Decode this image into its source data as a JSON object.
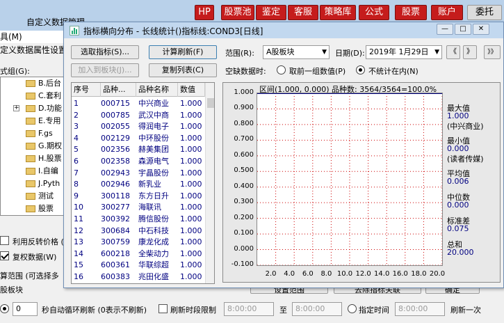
{
  "back_window": {
    "title": "自定义数据管理",
    "menu_fragment": "具(M)",
    "attr_label": "定义数据属性设置",
    "group_label": "式组(G):",
    "tree_items": [
      "B.后台",
      "C.套利",
      "D.功能",
      "E.专用",
      "F.gs ",
      "G.期权",
      "H.股票",
      "I.自编",
      "J.Pyth",
      "测试",
      "股票"
    ],
    "check_reverse": "利用反转价格 (K",
    "check_reinstate": "复权数据(W)",
    "calc_range_label": "算范围 (可选择多",
    "board_label": "股板块",
    "btn_set_range": "设置范围",
    "btn_delete_target": "去除指标关联",
    "btn_ok": "确定",
    "auto_refresh_value": "0",
    "auto_refresh_label": "秒自动循环刷新 (0表示不刷新)",
    "refresh_period_label": "刷新时段限制",
    "time_from": "8:00:00",
    "time_to_label": "至",
    "time_to": "8:00:00",
    "specified_time_label": "指定时间",
    "specified_time": "8:00:00",
    "refresh_once_label": "刷新一次"
  },
  "toolbar_buttons": [
    "HP",
    "股票池",
    "鉴定",
    "客服",
    "策略库",
    "公式",
    "股票",
    "账户",
    "委托"
  ],
  "dialog": {
    "title": "指标横向分布 - 长线统计()指标线:COND3[日线]",
    "btn_select_indicator": "选取指标(S)...",
    "btn_calc_refresh": "计算刷新(F)",
    "btn_add_to_board": "加入到板块(J)...",
    "btn_copy_list": "复制列表(C)",
    "range_label": "范围(R):",
    "range_value": "A股板块",
    "date_label": "日期(D):",
    "date_value": "2019年 1月29日",
    "nav_prev": "《",
    "nav_next": "》",
    "nav_last": "》》",
    "missing_label": "空缺数据时:",
    "radio_prev_group": "取前一组数值(P)",
    "radio_not_counted": "不统计在内(N)",
    "win_minimize": "—",
    "win_maximize": "□",
    "win_close": "✕"
  },
  "table": {
    "columns": [
      "序号",
      "品种...",
      "品种名称",
      "数值"
    ],
    "rows": [
      [
        "1",
        "000715",
        "中兴商业",
        "1.000"
      ],
      [
        "2",
        "000785",
        "武汉中商",
        "1.000"
      ],
      [
        "3",
        "002055",
        "得润电子",
        "1.000"
      ],
      [
        "4",
        "002129",
        "中环股份",
        "1.000"
      ],
      [
        "5",
        "002356",
        "赫美集团",
        "1.000"
      ],
      [
        "6",
        "002358",
        "森源电气",
        "1.000"
      ],
      [
        "7",
        "002943",
        "宇晶股份",
        "1.000"
      ],
      [
        "8",
        "002946",
        "新乳业",
        "1.000"
      ],
      [
        "9",
        "300118",
        "东方日升",
        "1.000"
      ],
      [
        "10",
        "300277",
        "海联讯",
        "1.000"
      ],
      [
        "11",
        "300392",
        "腾信股份",
        "1.000"
      ],
      [
        "12",
        "300684",
        "中石科技",
        "1.000"
      ],
      [
        "13",
        "300759",
        "康龙化成",
        "1.000"
      ],
      [
        "14",
        "600218",
        "全柴动力",
        "1.000"
      ],
      [
        "15",
        "600361",
        "华联综超",
        "1.000"
      ],
      [
        "16",
        "600383",
        "兆田化盛",
        "1.000"
      ]
    ]
  },
  "chart_data": {
    "type": "bar",
    "title": "区间(1.000, 0.000) 品种数: 3564/3564=100.0%",
    "ylim": [
      0,
      1
    ],
    "xlim": [
      0,
      20
    ],
    "yticks": [
      "1.000",
      "0.900",
      "0.800",
      "0.700",
      "0.600",
      "0.500",
      "0.400",
      "0.300",
      "0.200",
      "0.100",
      "0.000",
      "-0.100"
    ],
    "yticks_values": [
      1.0,
      0.9,
      0.8,
      0.7,
      0.6,
      0.5,
      0.4,
      0.3,
      0.2,
      0.1,
      0.0,
      -0.1
    ],
    "xticks": [
      "2.0",
      "4.0",
      "6.0",
      "8.0",
      "10.0",
      "12.0",
      "14.0",
      "16.0",
      "18.0",
      "20.0"
    ],
    "xticks_values": [
      2,
      4,
      6,
      8,
      10,
      12,
      14,
      16,
      18,
      20
    ],
    "grid": true,
    "stats": [
      {
        "label": "最大值",
        "value": "1.000",
        "note": "(中兴商业)"
      },
      {
        "label": "最小值",
        "value": "0.000",
        "note": "(读者传媒)"
      },
      {
        "label": "平均值",
        "value": "0.006"
      },
      {
        "label": "中位数",
        "value": "0.000"
      },
      {
        "label": "标准差",
        "value": "0.075"
      },
      {
        "label": "总和",
        "value": "20.000"
      }
    ]
  },
  "colors": {
    "accent": "#000080",
    "grid": "#cc0000",
    "title_bar": "#c2d8ef"
  }
}
